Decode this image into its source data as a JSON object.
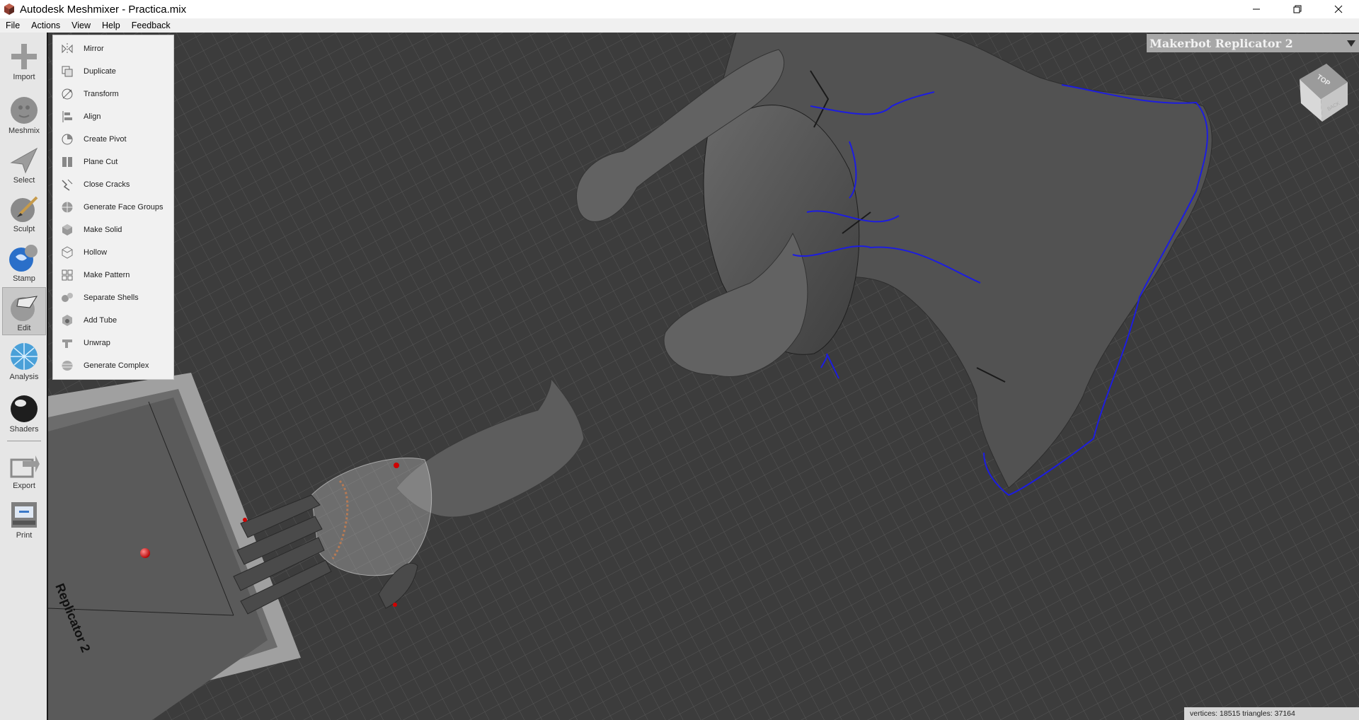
{
  "window": {
    "title": "Autodesk Meshmixer - Practica.mix"
  },
  "menu": [
    "File",
    "Actions",
    "View",
    "Help",
    "Feedback"
  ],
  "toolbar": {
    "items": [
      {
        "label": "Import",
        "icon": "plus-icon"
      },
      {
        "label": "Meshmix",
        "icon": "bust-icon"
      },
      {
        "label": "Select",
        "icon": "arrow-pointer-icon"
      },
      {
        "label": "Sculpt",
        "icon": "brush-sphere-icon"
      },
      {
        "label": "Stamp",
        "icon": "stamp-sphere-icon"
      },
      {
        "label": "Edit",
        "icon": "edit-sphere-icon",
        "active": true
      },
      {
        "label": "Analysis",
        "icon": "mesh-sphere-icon"
      },
      {
        "label": "Shaders",
        "icon": "shader-ball-icon"
      },
      {
        "label": "Export",
        "icon": "export-icon"
      },
      {
        "label": "Print",
        "icon": "printer-icon"
      }
    ]
  },
  "edit_menu": {
    "items": [
      {
        "label": "Mirror",
        "icon": "mirror-icon"
      },
      {
        "label": "Duplicate",
        "icon": "duplicate-icon"
      },
      {
        "label": "Transform",
        "icon": "transform-icon"
      },
      {
        "label": "Align",
        "icon": "align-icon"
      },
      {
        "label": "Create Pivot",
        "icon": "pivot-icon"
      },
      {
        "label": "Plane Cut",
        "icon": "plane-cut-icon"
      },
      {
        "label": "Close Cracks",
        "icon": "close-cracks-icon"
      },
      {
        "label": "Generate Face Groups",
        "icon": "face-groups-icon"
      },
      {
        "label": "Make Solid",
        "icon": "make-solid-icon"
      },
      {
        "label": "Hollow",
        "icon": "hollow-icon"
      },
      {
        "label": "Make Pattern",
        "icon": "pattern-icon"
      },
      {
        "label": "Separate Shells",
        "icon": "separate-shells-icon"
      },
      {
        "label": "Add Tube",
        "icon": "add-tube-icon"
      },
      {
        "label": "Unwrap",
        "icon": "unwrap-icon"
      },
      {
        "label": "Generate Complex",
        "icon": "complex-icon"
      }
    ]
  },
  "viewport": {
    "printer": "Makerbot Replicator 2",
    "bed_label": "Replicator 2",
    "viewcube_top": "TOP",
    "viewcube_back": "BACK",
    "status": "vertices: 18515 triangles: 37164"
  }
}
